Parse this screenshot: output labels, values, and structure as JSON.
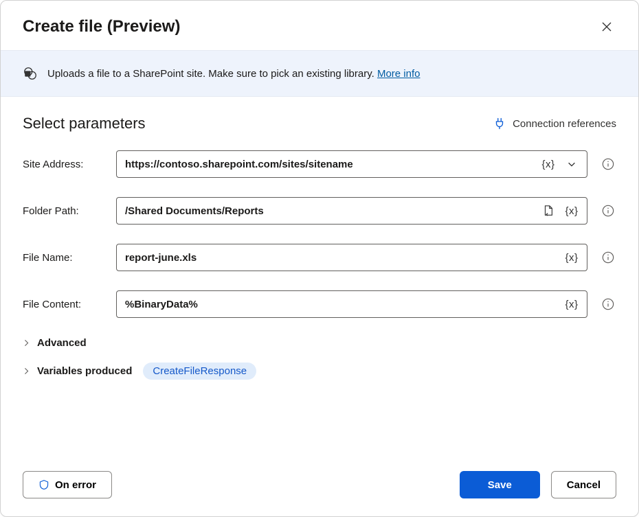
{
  "header": {
    "title": "Create file (Preview)"
  },
  "banner": {
    "text": "Uploads a file to a SharePoint site. Make sure to pick an existing library.",
    "link_label": "More info"
  },
  "section": {
    "title": "Select parameters",
    "connection_label": "Connection references"
  },
  "params": {
    "site_address": {
      "label": "Site Address:",
      "value": "https://contoso.sharepoint.com/sites/sitename"
    },
    "folder_path": {
      "label": "Folder Path:",
      "value": "/Shared Documents/Reports"
    },
    "file_name": {
      "label": "File Name:",
      "value": "report-june.xls"
    },
    "file_content": {
      "label": "File Content:",
      "value": "%BinaryData%"
    },
    "token_label": "{x}"
  },
  "expanders": {
    "advanced": "Advanced",
    "variables_produced": "Variables produced",
    "variable_pill": "CreateFileResponse"
  },
  "footer": {
    "on_error": "On error",
    "save": "Save",
    "cancel": "Cancel"
  }
}
